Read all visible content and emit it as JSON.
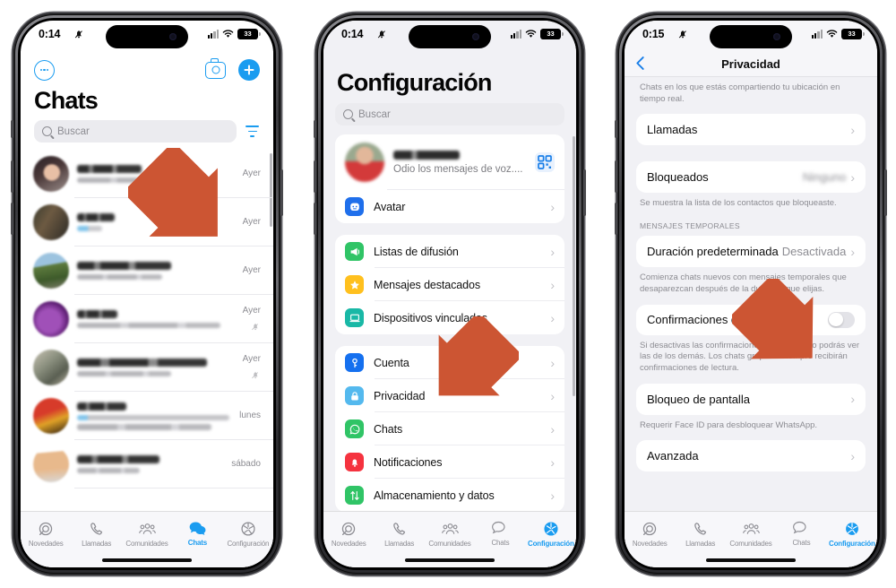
{
  "phones": [
    {
      "id": "chats",
      "status": {
        "time": "0:14",
        "mute_icon": "bell-slash-icon",
        "battery": "33",
        "signal_icon": "cellular-icon",
        "wifi_icon": "wifi-icon"
      },
      "header": {
        "more_icon": "more-circle-icon",
        "camera_icon": "camera-icon",
        "new_chat_icon": "plus-icon",
        "title": "Chats"
      },
      "search": {
        "placeholder": "Buscar",
        "icon": "search-icon",
        "filter_icon": "filter-icon"
      },
      "chats": [
        {
          "time": "Ayer",
          "muted": false,
          "two_line_preview": false
        },
        {
          "time": "Ayer",
          "muted": false,
          "two_line_preview": false
        },
        {
          "time": "Ayer",
          "muted": false,
          "two_line_preview": false
        },
        {
          "time": "Ayer",
          "muted": true,
          "two_line_preview": false
        },
        {
          "time": "Ayer",
          "muted": true,
          "two_line_preview": false
        },
        {
          "time": "lunes",
          "muted": false,
          "two_line_preview": true
        },
        {
          "time": "sábado",
          "muted": false,
          "two_line_preview": false
        }
      ],
      "tabs": [
        {
          "label": "Novedades",
          "icon": "updates-icon",
          "active": false
        },
        {
          "label": "Llamadas",
          "icon": "phone-icon",
          "active": false
        },
        {
          "label": "Comunidades",
          "icon": "communities-icon",
          "active": false
        },
        {
          "label": "Chats",
          "icon": "chats-icon",
          "active": true
        },
        {
          "label": "Configuración",
          "icon": "gear-icon",
          "active": false
        }
      ]
    },
    {
      "id": "settings",
      "status": {
        "time": "0:14",
        "mute_icon": "bell-slash-icon",
        "battery": "33",
        "signal_icon": "cellular-icon",
        "wifi_icon": "wifi-icon"
      },
      "title": "Configuración",
      "search": {
        "placeholder": "Buscar",
        "icon": "search-icon"
      },
      "profile": {
        "status_text": "Odio los mensajes de voz....",
        "qr_icon": "qr-code-icon"
      },
      "groups": [
        {
          "items": [
            {
              "label": "Avatar",
              "icon": "avatar-icon",
              "color": "#1f6feb"
            }
          ]
        },
        {
          "items": [
            {
              "label": "Listas de difusión",
              "icon": "megaphone-icon",
              "color": "#30c466"
            },
            {
              "label": "Mensajes destacados",
              "icon": "star-icon",
              "color": "#ffc01e"
            },
            {
              "label": "Dispositivos vinculados",
              "icon": "laptop-icon",
              "color": "#19b8a6"
            }
          ]
        },
        {
          "items": [
            {
              "label": "Cuenta",
              "icon": "key-icon",
              "color": "#1570ef"
            },
            {
              "label": "Privacidad",
              "icon": "lock-icon",
              "color": "#54b9ee"
            },
            {
              "label": "Chats",
              "icon": "whatsapp-icon",
              "color": "#30c466"
            },
            {
              "label": "Notificaciones",
              "icon": "bell-icon",
              "color": "#f5333f"
            },
            {
              "label": "Almacenamiento y datos",
              "icon": "arrows-updown-icon",
              "color": "#30c466"
            }
          ]
        }
      ],
      "tabs": [
        {
          "label": "Novedades",
          "icon": "updates-icon",
          "active": false
        },
        {
          "label": "Llamadas",
          "icon": "phone-icon",
          "active": false
        },
        {
          "label": "Comunidades",
          "icon": "communities-icon",
          "active": false
        },
        {
          "label": "Chats",
          "icon": "chats-icon",
          "active": false
        },
        {
          "label": "Configuración",
          "icon": "gear-icon",
          "active": true
        }
      ]
    },
    {
      "id": "privacy",
      "status": {
        "time": "0:15",
        "mute_icon": "bell-slash-icon",
        "battery": "33",
        "signal_icon": "cellular-icon",
        "wifi_icon": "wifi-icon"
      },
      "navbar": {
        "back_icon": "chevron-left-icon",
        "title": "Privacidad"
      },
      "top_footnote": "Chats en los que estás compartiendo tu ubicación en tiempo real.",
      "rows": {
        "llamadas": {
          "label": "Llamadas"
        },
        "bloqueados": {
          "label": "Bloqueados",
          "value": "Ninguno",
          "footnote": "Se muestra la lista de los contactos que bloqueaste."
        },
        "section_temporales": "MENSAJES TEMPORALES",
        "duracion": {
          "label": "Duración predeterminada",
          "value": "Desactivada",
          "footnote": "Comienza chats nuevos con mensajes temporales que desaparezcan después de la duración que elijas."
        },
        "confirmaciones": {
          "label": "Confirmaciones de lectura",
          "toggle": "off",
          "footnote": "Si desactivas las confirmaciones de lectura, no podrás ver las de los demás. Los chats grupales siempre recibirán confirmaciones de lectura."
        },
        "bloqueo": {
          "label": "Bloqueo de pantalla",
          "footnote": "Requerir Face ID para desbloquear WhatsApp."
        },
        "avanzada": {
          "label": "Avanzada"
        }
      },
      "tabs": [
        {
          "label": "Novedades",
          "icon": "updates-icon",
          "active": false
        },
        {
          "label": "Llamadas",
          "icon": "phone-icon",
          "active": false
        },
        {
          "label": "Comunidades",
          "icon": "communities-icon",
          "active": false
        },
        {
          "label": "Chats",
          "icon": "chats-icon",
          "active": false
        },
        {
          "label": "Configuración",
          "icon": "gear-icon",
          "active": true
        }
      ]
    }
  ],
  "annotations": {
    "arrow_color": "#cc5533",
    "arrows": [
      {
        "name": "arrow-to-configuracion-tab",
        "target": "Configuración"
      },
      {
        "name": "arrow-to-privacidad-item",
        "target": "Privacidad"
      },
      {
        "name": "arrow-to-confirmaciones-de-lectura",
        "target": "Confirmaciones de lectura"
      }
    ]
  }
}
